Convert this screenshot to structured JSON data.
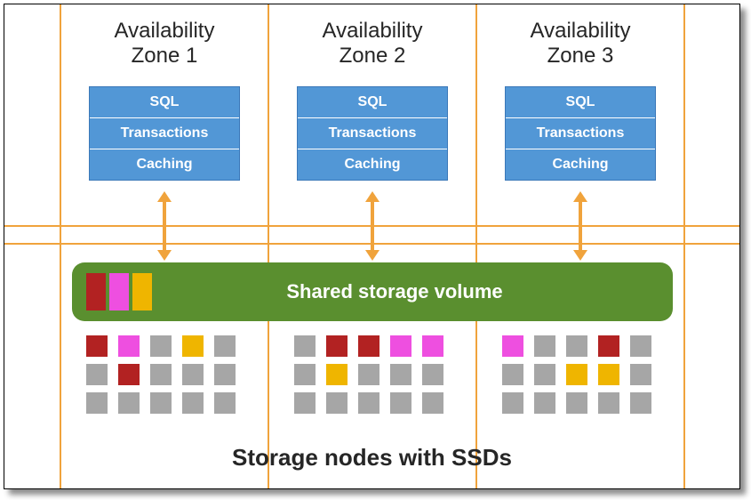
{
  "zones": [
    {
      "title": "Availability\nZone 1",
      "layers": [
        "SQL",
        "Transactions",
        "Caching"
      ]
    },
    {
      "title": "Availability\nZone 2",
      "layers": [
        "SQL",
        "Transactions",
        "Caching"
      ]
    },
    {
      "title": "Availability\nZone 3",
      "layers": [
        "SQL",
        "Transactions",
        "Caching"
      ]
    }
  ],
  "shared_volume": {
    "label": "Shared storage volume",
    "chips": [
      "red",
      "magenta",
      "gold"
    ]
  },
  "storage_groups": [
    {
      "rows": [
        [
          "red",
          "magenta",
          "gray",
          "gold",
          "gray"
        ],
        [
          "gray",
          "red",
          "gray",
          "gray",
          "gray"
        ],
        [
          "gray",
          "gray",
          "gray",
          "gray",
          "gray"
        ]
      ]
    },
    {
      "rows": [
        [
          "gray",
          "red",
          "red",
          "magenta",
          "magenta"
        ],
        [
          "gray",
          "gold",
          "gray",
          "gray",
          "gray"
        ],
        [
          "gray",
          "gray",
          "gray",
          "gray",
          "gray"
        ]
      ]
    },
    {
      "rows": [
        [
          "magenta",
          "gray",
          "gray",
          "red",
          "gray"
        ],
        [
          "gray",
          "gray",
          "gold",
          "gold",
          "gray"
        ],
        [
          "gray",
          "gray",
          "gray",
          "gray",
          "gray"
        ]
      ]
    }
  ],
  "caption": "Storage nodes with SSDs",
  "colors": {
    "red": "#b22222",
    "magenta": "#ee4fe0",
    "gold": "#efb500",
    "gray": "#a6a6a6"
  }
}
